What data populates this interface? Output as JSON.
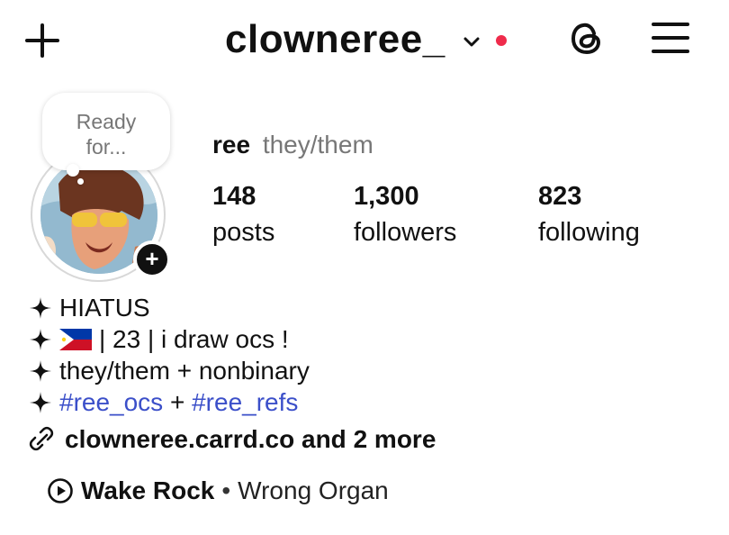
{
  "header": {
    "username": "clowneree_",
    "has_notification_dot": true,
    "dot_color": "#ef2b4b",
    "icons": [
      "plus-icon",
      "chevron-down-icon",
      "threads-icon",
      "hamburger-menu-icon"
    ]
  },
  "note": {
    "line1": "Ready",
    "line2": "for..."
  },
  "profile": {
    "name": "ree",
    "pronouns": "they/them"
  },
  "stats": {
    "posts": {
      "value": "148",
      "label": "posts"
    },
    "followers": {
      "value": "1,300",
      "label": "followers"
    },
    "following": {
      "value": "823",
      "label": "following"
    }
  },
  "bio": {
    "line1": "HIATUS",
    "line2_flag": "philippines-flag",
    "line2_text": "| 23 | i draw ocs !",
    "line3": "they/them + nonbinary",
    "line4_tag1": "#ree_ocs",
    "line4_mid": " + ",
    "line4_tag2": "#ree_refs"
  },
  "link": {
    "text": "clowneree.carrd.co and 2 more"
  },
  "music": {
    "song": "Wake Rock",
    "separator": "•",
    "artist": "Wrong Organ"
  },
  "colors": {
    "hashtag": "#3b4fc9",
    "secondary_text": "#777777"
  }
}
